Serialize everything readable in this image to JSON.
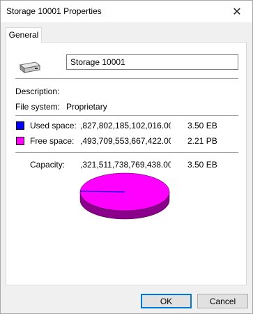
{
  "window": {
    "title": "Storage 10001 Properties",
    "close_icon": "close-icon"
  },
  "tabs": [
    {
      "label": "General",
      "selected": true
    }
  ],
  "general": {
    "drive_icon": "drive-icon",
    "name_value": "Storage 10001",
    "description_label": "Description:",
    "filesystem_label": "File system:",
    "filesystem_value": "Proprietary",
    "used": {
      "label": "Used space:",
      "bytes": ",827,802,185,102,016.00",
      "size": "3.50 EB",
      "color": "#0000ff"
    },
    "free": {
      "label": "Free space:",
      "bytes": ",493,709,553,667,422.00",
      "size": "2.21 PB",
      "color": "#ff00ff"
    },
    "capacity": {
      "label": "Capacity:",
      "bytes": ",321,511,738,769,438.00",
      "size": "3.50 EB"
    },
    "pie": {
      "used_color": "#0000ff",
      "free_color": "#ff00ff",
      "free_side_color": "#8b008b"
    }
  },
  "buttons": {
    "ok": "OK",
    "cancel": "Cancel"
  }
}
